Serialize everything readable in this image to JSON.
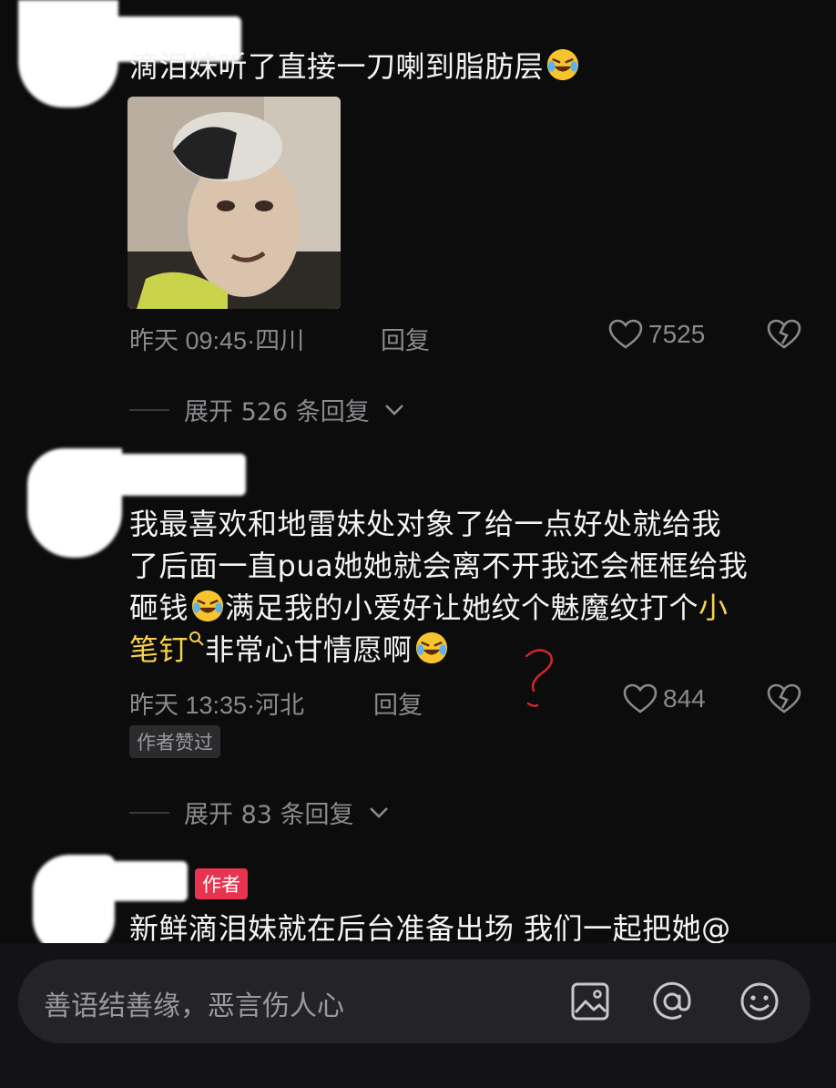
{
  "comments": [
    {
      "text": "滴泪妹听了直接一刀喇到脂肪层",
      "time": "昨天 09:45",
      "location": "四川",
      "reply_label": "回复",
      "likes": "7525",
      "expand_label": "展开 526 条回复"
    },
    {
      "text_line1": "我最喜欢和地雷妹处对象了给一点好处就给我",
      "text_line2": "了后面一直pua她她就会离不开我还会框框给我",
      "text_line3a": "砸钱",
      "text_line3b": "满足我的小爱好让她纹个魅魔纹打个",
      "text_highlight_a": "小",
      "text_highlight_b": "笔钉",
      "text_line4": "非常心甘情愿啊",
      "time": "昨天 13:35",
      "location": "河北",
      "reply_label": "回复",
      "likes": "844",
      "liked_badge": "作者赞过",
      "expand_label": "展开 83 条回复"
    },
    {
      "author_badge": "作者",
      "text": "新鲜滴泪妹就在后台准备出场 我们一起把她@"
    }
  ],
  "annotation_mark": "?",
  "input": {
    "placeholder": "善语结善缘，恶言伤人心"
  },
  "icons": [
    "image-icon",
    "at-icon",
    "emoji-icon",
    "heart-icon",
    "dislike-icon",
    "chevron-down-icon",
    "search-icon"
  ],
  "colors": {
    "background": "#0c0c0d",
    "highlight": "#f7d24a",
    "author_badge": "#e8344e",
    "meta": "#8a8a8e"
  }
}
